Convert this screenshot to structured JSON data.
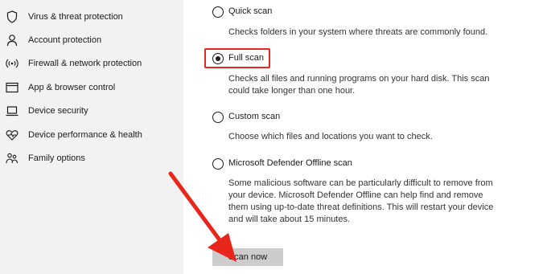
{
  "sidebar": {
    "items": [
      {
        "label": "Virus & threat protection",
        "icon": "shield-icon"
      },
      {
        "label": "Account protection",
        "icon": "person-icon"
      },
      {
        "label": "Firewall & network protection",
        "icon": "wifi-icon"
      },
      {
        "label": "App & browser control",
        "icon": "browser-window-icon"
      },
      {
        "label": "Device security",
        "icon": "laptop-icon"
      },
      {
        "label": "Device performance & health",
        "icon": "heart-pulse-icon"
      },
      {
        "label": "Family options",
        "icon": "family-icon"
      }
    ]
  },
  "scan_options": [
    {
      "title": "Quick scan",
      "selected": false,
      "description": "Checks folders in your system where threats are commonly found."
    },
    {
      "title": "Full scan",
      "selected": true,
      "description": "Checks all files and running programs on your hard disk. This scan could take longer than one hour."
    },
    {
      "title": "Custom scan",
      "selected": false,
      "description": "Choose which files and locations you want to check."
    },
    {
      "title": "Microsoft Defender Offline scan",
      "selected": false,
      "description": "Some malicious software can be particularly difficult to remove from your device. Microsoft Defender Offline can help find and remove them using up-to-date threat definitions. This will restart your device and will take about 15 minutes."
    }
  ],
  "scan_button": {
    "label": "Scan now"
  },
  "colors": {
    "annotation": "#e8261c",
    "sidebar_bg": "#f2f2f2",
    "button_bg": "#cccccc"
  }
}
